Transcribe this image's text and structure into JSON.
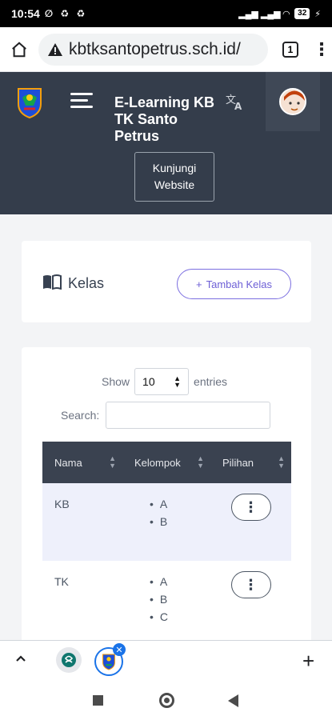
{
  "statusbar": {
    "time": "10:54",
    "left_icons": "∅ ♻ ♻",
    "signal": "▂▄▆ ▂▄▆ ◠",
    "battery": "32"
  },
  "browser": {
    "url": "kbtksantopetrus.sch.id/",
    "tab_count": "1"
  },
  "header": {
    "title": "E-Learning KB TK Santo Petrus",
    "website_button": "Kunjungi Website",
    "translate_icon": "translate-icon"
  },
  "kelas_card": {
    "heading": "Kelas",
    "add_button": "Tambah Kelas"
  },
  "table_controls": {
    "show_label": "Show",
    "entries_value": "10",
    "entries_label": "entries",
    "search_label": "Search:"
  },
  "table": {
    "columns": [
      "Nama",
      "Kelompok",
      "Pilihan"
    ],
    "rows": [
      {
        "nama": "KB",
        "kelompok": [
          "A",
          "B"
        ]
      },
      {
        "nama": "TK",
        "kelompok": [
          "A",
          "B",
          "C"
        ]
      }
    ]
  },
  "colors": {
    "header_bg": "#343d4b",
    "accent": "#6d5fd6",
    "table_header": "#3a4250",
    "row_highlight": "#eef0fb"
  }
}
